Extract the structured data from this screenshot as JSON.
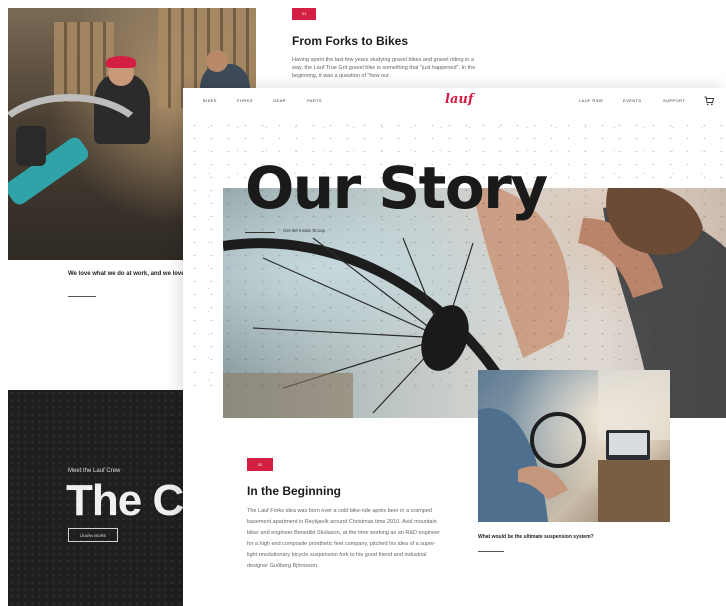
{
  "back_left": {
    "caption": "We love what we do at work, and we love it",
    "crew_kicker": "Meet the Lauf Crew",
    "crew_headline": "The C",
    "learn_more": "LEARN MORE"
  },
  "back_top": {
    "badge": "01",
    "title": "From Forks to Bikes",
    "text": "Having spent the last few years studying gravel bikes and gravel riding in a way, the Lauf True Grit gravel bike is something that \"just happened\". In the beginning, it was a question of \"how our"
  },
  "nav": {
    "left_items": [
      "BIKES",
      "FORKS",
      "GEAR",
      "PARTS"
    ],
    "logo": "lauf",
    "right_items": [
      "LAUF RIDE",
      "EVENTS",
      "SUPPORT"
    ]
  },
  "hero": {
    "title": "Our Story",
    "subtitle": "Get the Inside Scoop"
  },
  "section": {
    "badge": "02",
    "title": "In the Beginning",
    "text": "The Lauf Forks idea was born over a cold bike-ride après beer in a cramped basement apartment in Reykjavík around Christmas time 2010. Avid mountain biker and engineer Benedikt Skúlason, at the time working as an R&D engineer for a high end composite prosthetic feet company, pitched his idea of a super-light revolutionary bicycle suspension fork to his good friend and industrial designer Guðberg Björnsson.",
    "question": "What would be the ultimate suspension system?"
  },
  "colors": {
    "accent": "#d31f41",
    "dark_panel": "#1f1f1f",
    "text_dark": "#1c1c1c"
  },
  "icons": {
    "cart": "cart-icon"
  }
}
